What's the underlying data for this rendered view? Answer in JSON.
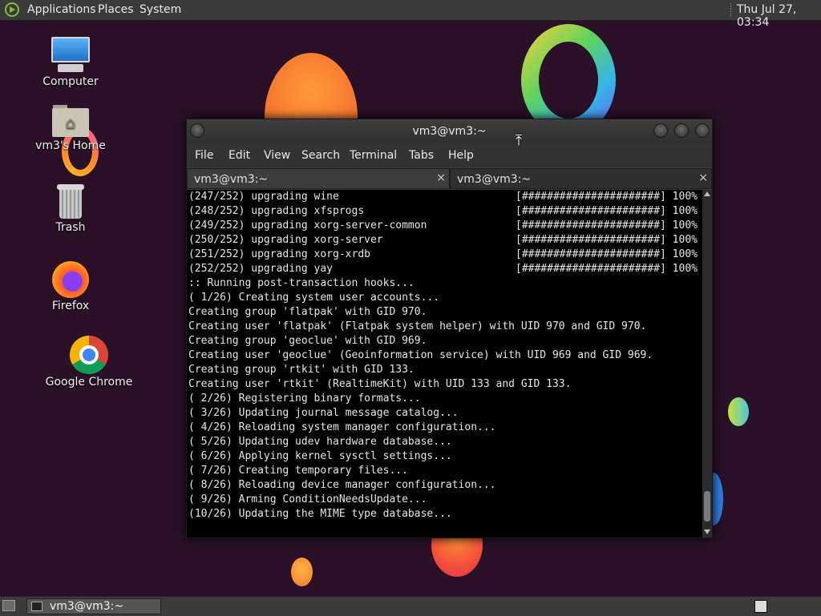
{
  "top_panel": {
    "menus": [
      "Applications",
      "Places",
      "System"
    ],
    "clock": "Thu Jul 27, 03:34"
  },
  "desktop": {
    "icons": [
      {
        "label": "Computer",
        "icon": "computer-icon"
      },
      {
        "label": "vm3's Home",
        "icon": "home-folder-icon"
      },
      {
        "label": "Trash",
        "icon": "trash-icon"
      },
      {
        "label": "Firefox",
        "icon": "firefox-icon"
      },
      {
        "label": "Google Chrome",
        "icon": "chrome-icon"
      }
    ]
  },
  "terminal": {
    "title": "vm3@vm3:~",
    "menu": [
      "File",
      "Edit",
      "View",
      "Search",
      "Terminal",
      "Tabs",
      "Help"
    ],
    "tabs": [
      {
        "label": "vm3@vm3:~",
        "close": "×"
      },
      {
        "label": "vm3@vm3:~",
        "close": "×"
      }
    ],
    "lines": [
      {
        "text": "(247/252) upgrading wine",
        "progress": "[######################] 100%"
      },
      {
        "text": "(248/252) upgrading xfsprogs",
        "progress": "[######################] 100%"
      },
      {
        "text": "(249/252) upgrading xorg-server-common",
        "progress": "[######################] 100%"
      },
      {
        "text": "(250/252) upgrading xorg-server",
        "progress": "[######################] 100%"
      },
      {
        "text": "(251/252) upgrading xorg-xrdb",
        "progress": "[######################] 100%"
      },
      {
        "text": "(252/252) upgrading yay",
        "progress": "[######################] 100%"
      },
      {
        "text": ":: Running post-transaction hooks...",
        "progress": ""
      },
      {
        "text": "( 1/26) Creating system user accounts...",
        "progress": ""
      },
      {
        "text": "Creating group 'flatpak' with GID 970.",
        "progress": ""
      },
      {
        "text": "Creating user 'flatpak' (Flatpak system helper) with UID 970 and GID 970.",
        "progress": ""
      },
      {
        "text": "Creating group 'geoclue' with GID 969.",
        "progress": ""
      },
      {
        "text": "Creating user 'geoclue' (Geoinformation service) with UID 969 and GID 969.",
        "progress": ""
      },
      {
        "text": "Creating group 'rtkit' with GID 133.",
        "progress": ""
      },
      {
        "text": "Creating user 'rtkit' (RealtimeKit) with UID 133 and GID 133.",
        "progress": ""
      },
      {
        "text": "( 2/26) Registering binary formats...",
        "progress": ""
      },
      {
        "text": "( 3/26) Updating journal message catalog...",
        "progress": ""
      },
      {
        "text": "( 4/26) Reloading system manager configuration...",
        "progress": ""
      },
      {
        "text": "( 5/26) Updating udev hardware database...",
        "progress": ""
      },
      {
        "text": "( 6/26) Applying kernel sysctl settings...",
        "progress": ""
      },
      {
        "text": "( 7/26) Creating temporary files...",
        "progress": ""
      },
      {
        "text": "( 8/26) Reloading device manager configuration...",
        "progress": ""
      },
      {
        "text": "( 9/26) Arming ConditionNeedsUpdate...",
        "progress": ""
      },
      {
        "text": "(10/26) Updating the MIME type database...",
        "progress": ""
      }
    ]
  },
  "taskbar": {
    "window_label": "vm3@vm3:~"
  },
  "colors": {
    "desktop_bg": "#2a1128",
    "panel_bg": "#3b3b3b",
    "terminal_bg": "#000000",
    "terminal_fg": "#e6e6e6"
  }
}
